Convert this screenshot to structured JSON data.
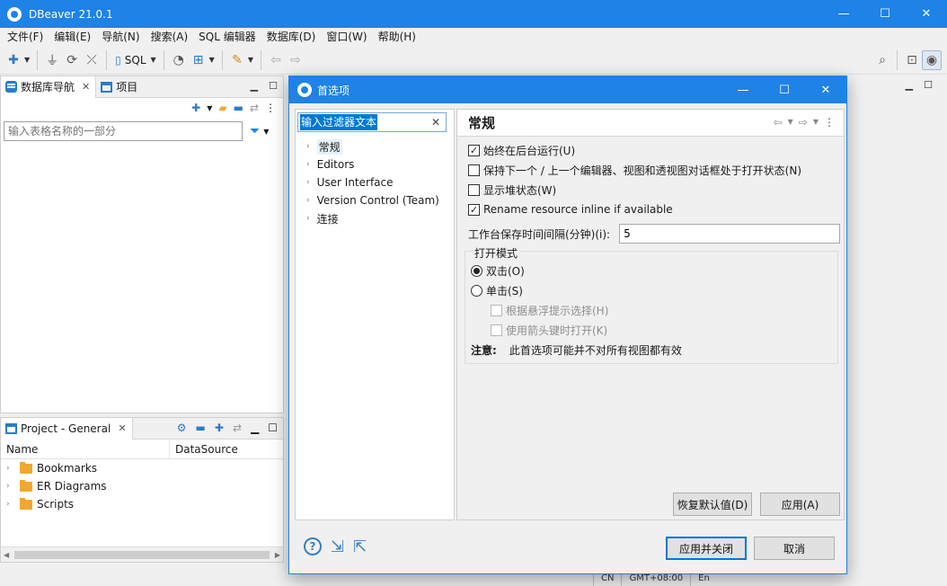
{
  "window": {
    "title": "DBeaver 21.0.1",
    "minimize_glyph": "—",
    "maximize_glyph": "☐",
    "close_glyph": "✕"
  },
  "menu": [
    "文件(F)",
    "编辑(E)",
    "导航(N)",
    "搜索(A)",
    "SQL 编辑器",
    "数据库(D)",
    "窗口(W)",
    "帮助(H)"
  ],
  "toolbar": {
    "sql_label": "SQL"
  },
  "navigator": {
    "tab_label": "数据库导航",
    "projects_tab_label": "项目",
    "filter_placeholder": "输入表格名称的一部分"
  },
  "project_pane": {
    "tab_label": "Project - General",
    "columns": [
      "Name",
      "DataSource"
    ],
    "items": [
      "Bookmarks",
      "ER Diagrams",
      "Scripts"
    ]
  },
  "status_fragments": [
    "CN",
    "GMT+08:00",
    "En"
  ],
  "dialog": {
    "title": "首选项",
    "filter_text": "输入过滤器文本",
    "tree": [
      "常规",
      "Editors",
      "User Interface",
      "Version Control (Team)",
      "连接"
    ],
    "page_title": "常规",
    "checkboxes": [
      {
        "label": "始终在后台运行(U)",
        "checked": true
      },
      {
        "label": "保持下一个 / 上一个编辑器、视图和透视图对话框处于打开状态(N)",
        "checked": false
      },
      {
        "label": "显示堆状态(W)",
        "checked": false
      },
      {
        "label": "Rename resource inline if available",
        "checked": true
      }
    ],
    "interval_label": "工作台保存时间间隔(分钟)(i):",
    "interval_value": "5",
    "open_mode": {
      "legend": "打开模式",
      "double_click": "双击(O)",
      "single_click": "单击(S)",
      "selected": "double",
      "hover_select": "根据悬浮提示选择(H)",
      "arrow_open": "使用箭头键时打开(K)",
      "note_label": "注意:",
      "note_text": "此首选项可能并不对所有视图都有效"
    },
    "restore_defaults": "恢复默认值(D)",
    "apply": "应用(A)",
    "apply_close": "应用并关闭",
    "cancel": "取消"
  }
}
